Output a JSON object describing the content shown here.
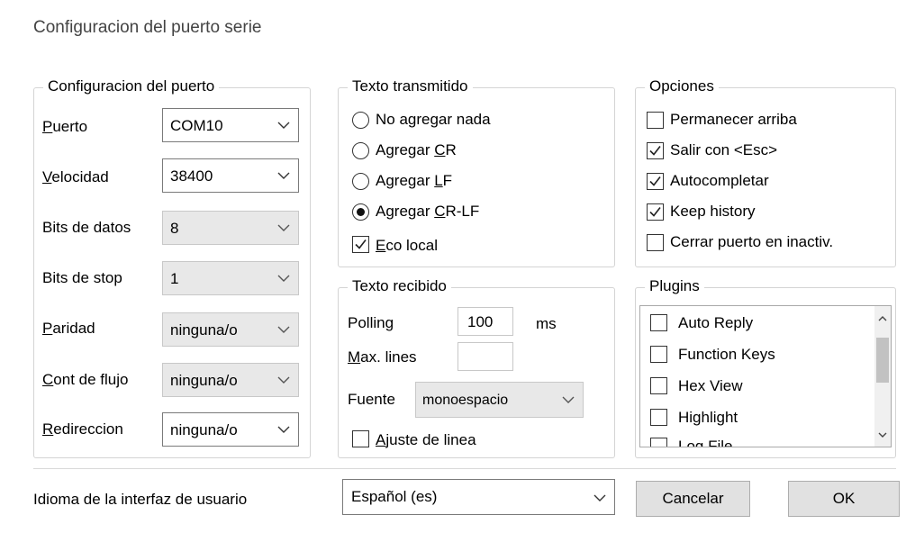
{
  "window": {
    "title": "Configuracion del puerto serie"
  },
  "port_config": {
    "title": "Configuracion del puerto",
    "puerto": {
      "label_u": "P",
      "label_rest": "uerto",
      "value": "COM10"
    },
    "velocidad": {
      "label_u": "V",
      "label_rest": "elocidad",
      "value": "38400"
    },
    "bits_datos": {
      "label": "Bits de datos",
      "value": "8"
    },
    "bits_stop": {
      "label": "Bits de stop",
      "value": "1"
    },
    "paridad": {
      "label_u": "P",
      "label_rest": "aridad",
      "value": "ninguna/o"
    },
    "flujo": {
      "label_u": "C",
      "label_rest": "ont de flujo",
      "value": "ninguna/o"
    },
    "redireccion": {
      "label_u": "R",
      "label_rest": "edireccion",
      "value": "ninguna/o"
    }
  },
  "tx": {
    "title": "Texto transmitido",
    "options": [
      {
        "pre": "No agregar nada",
        "u": "",
        "post": "",
        "selected": false
      },
      {
        "pre": "Agregar ",
        "u": "C",
        "post": "R",
        "selected": false
      },
      {
        "pre": "Agregar ",
        "u": "L",
        "post": "F",
        "selected": false
      },
      {
        "pre": "Agregar ",
        "u": "C",
        "post": "R-LF",
        "selected": true
      }
    ],
    "eco": {
      "u": "E",
      "rest": "co local",
      "checked": true
    }
  },
  "rx": {
    "title": "Texto recibido",
    "polling_label": "Polling",
    "polling_value": "100",
    "polling_unit": "ms",
    "maxlines_u": "M",
    "maxlines_rest": "ax. lines",
    "maxlines_value": "",
    "fuente_label": "Fuente",
    "fuente_value": "monoespacio",
    "ajuste_u": "A",
    "ajuste_rest": "juste de linea",
    "ajuste_checked": false
  },
  "options": {
    "title": "Opciones",
    "items": [
      {
        "label": "Permanecer arriba",
        "checked": false
      },
      {
        "label": "Salir con <Esc>",
        "checked": true
      },
      {
        "label": "Autocompletar",
        "checked": true
      },
      {
        "label": "Keep history",
        "checked": true
      },
      {
        "label": "Cerrar puerto en inactiv.",
        "checked": false
      }
    ]
  },
  "plugins": {
    "title": "Plugins",
    "items": [
      "Auto Reply",
      "Function Keys",
      "Hex View",
      "Highlight",
      "Log File"
    ]
  },
  "footer": {
    "language_label": "Idioma de la interfaz de usuario",
    "language_value": "Español (es)",
    "cancel_label": "Cancelar",
    "ok_label": "OK"
  }
}
